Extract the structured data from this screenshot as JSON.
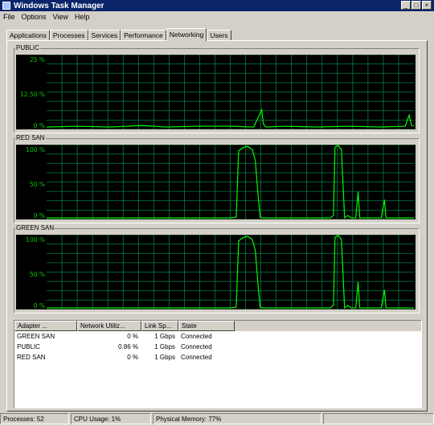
{
  "window": {
    "title": "Windows Task Manager",
    "controls": [
      "_",
      "□",
      "×"
    ]
  },
  "menu": [
    "File",
    "Options",
    "View",
    "Help"
  ],
  "tabs": [
    {
      "label": "Applications",
      "active": false
    },
    {
      "label": "Processes",
      "active": false
    },
    {
      "label": "Services",
      "active": false
    },
    {
      "label": "Performance",
      "active": false
    },
    {
      "label": "Networking",
      "active": true
    },
    {
      "label": "Users",
      "active": false
    }
  ],
  "graphs": [
    {
      "name": "PUBLIC",
      "ticks": [
        "25 %",
        "12.50 %",
        "0 %"
      ]
    },
    {
      "name": "RED SAN",
      "ticks": [
        "100 %",
        "50 %",
        "0 %"
      ]
    },
    {
      "name": "GREEN SAN",
      "ticks": [
        "100 %",
        "50 %",
        "0 %"
      ]
    }
  ],
  "adapters": {
    "columns": [
      "Adapter ...",
      "Network Utiliz...",
      "Link Sp...",
      "State"
    ],
    "rows": [
      [
        "GREEN SAN",
        "0 %",
        "1 Gbps",
        "Connected"
      ],
      [
        "PUBLIC",
        "0.86 %",
        "1 Gbps",
        "Connected"
      ],
      [
        "RED SAN",
        "0 %",
        "1 Gbps",
        "Connected"
      ]
    ]
  },
  "status": {
    "processes": "Processes: 52",
    "cpu": "CPU Usage: 1%",
    "memory": "Physical Memory: 77%"
  },
  "colors": {
    "graph_bg": "#000000",
    "grid": "#008040",
    "trace": "#00ff00",
    "title_bar": "#0a246a"
  }
}
